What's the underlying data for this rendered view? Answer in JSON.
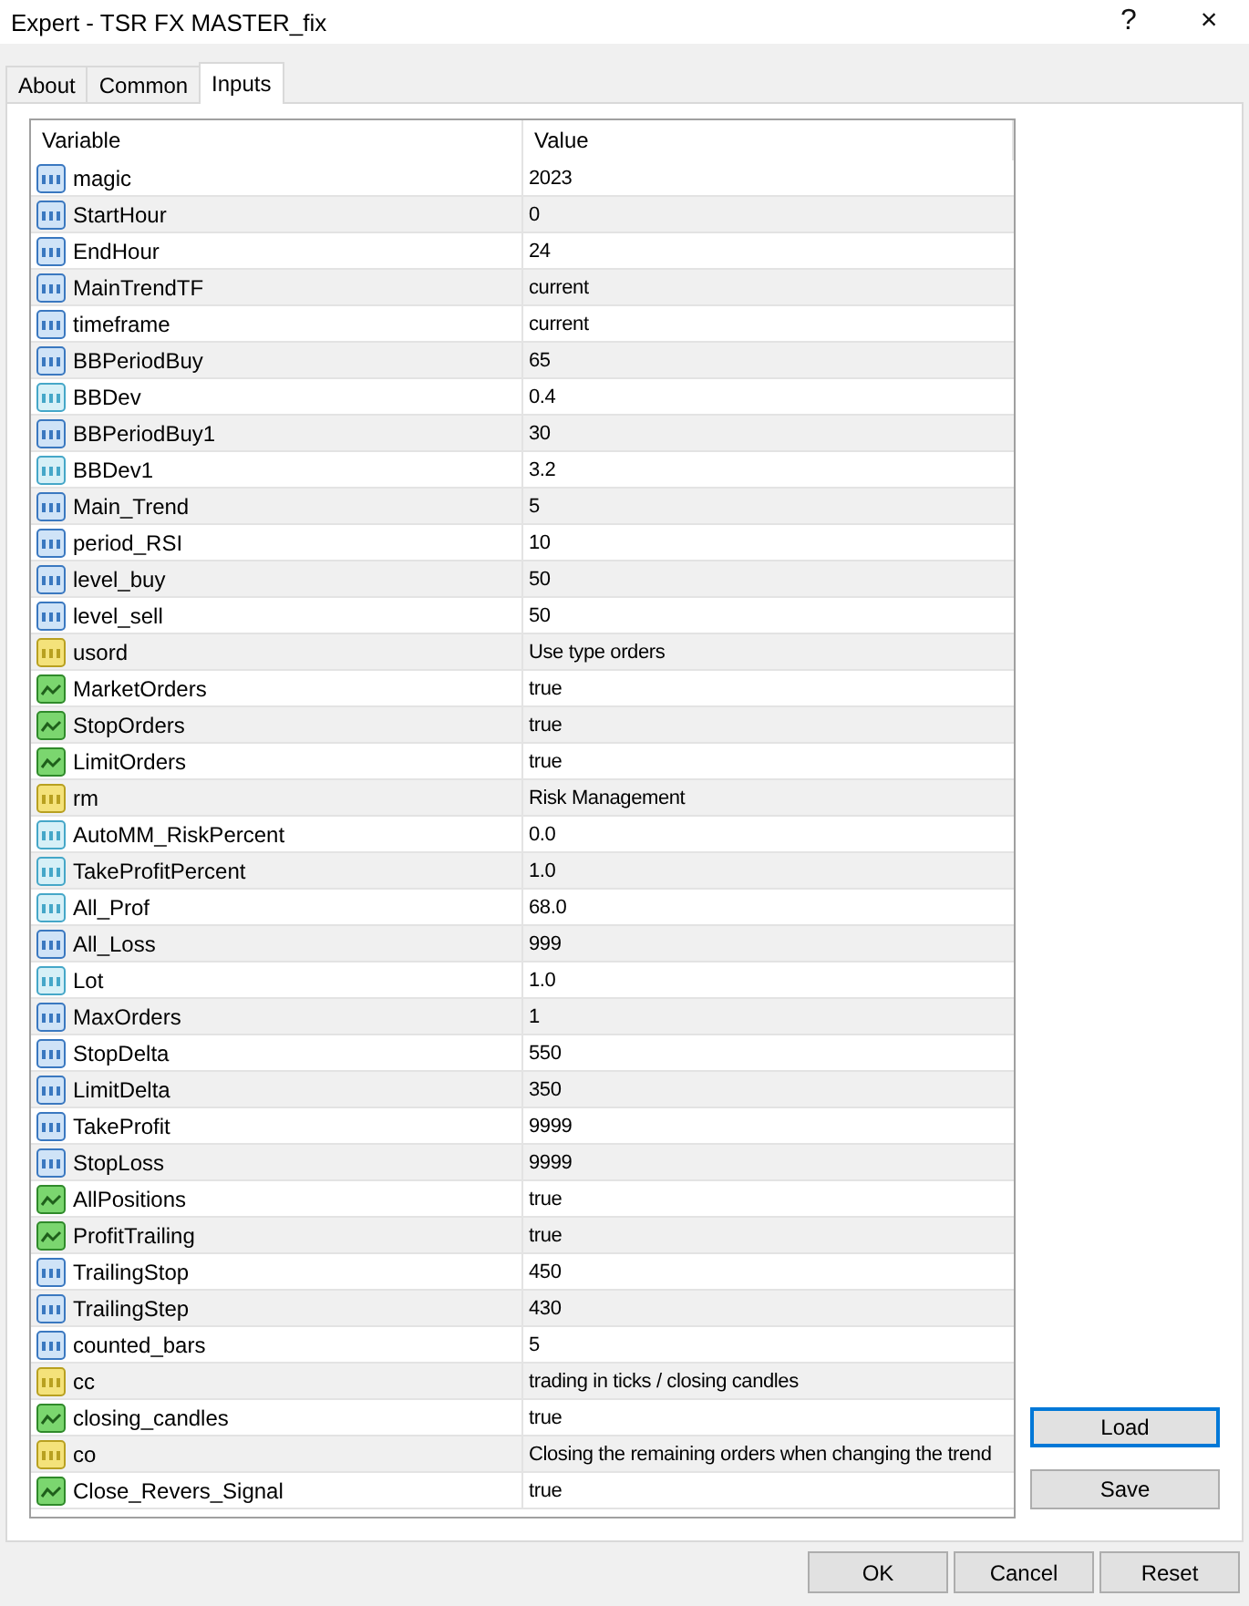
{
  "window": {
    "title": "Expert - TSR FX MASTER_fix",
    "help": "?",
    "close": "×"
  },
  "tabs": [
    {
      "label": "About",
      "selected": false
    },
    {
      "label": "Common",
      "selected": false
    },
    {
      "label": "Inputs",
      "selected": true
    }
  ],
  "table": {
    "columns": [
      "Variable",
      "Value"
    ],
    "rows": [
      {
        "kind": "int",
        "name": "magic",
        "value": "2023"
      },
      {
        "kind": "int",
        "name": "StartHour",
        "value": "0"
      },
      {
        "kind": "int",
        "name": "EndHour",
        "value": "24"
      },
      {
        "kind": "int",
        "name": "MainTrendTF",
        "value": "current"
      },
      {
        "kind": "int",
        "name": "timeframe",
        "value": "current"
      },
      {
        "kind": "int",
        "name": "BBPeriodBuy",
        "value": "65"
      },
      {
        "kind": "double",
        "name": "BBDev",
        "value": "0.4"
      },
      {
        "kind": "int",
        "name": "BBPeriodBuy1",
        "value": "30"
      },
      {
        "kind": "double",
        "name": "BBDev1",
        "value": "3.2"
      },
      {
        "kind": "int",
        "name": "Main_Trend",
        "value": "5"
      },
      {
        "kind": "int",
        "name": "period_RSI",
        "value": "10"
      },
      {
        "kind": "int",
        "name": "level_buy",
        "value": "50"
      },
      {
        "kind": "int",
        "name": "level_sell",
        "value": "50"
      },
      {
        "kind": "string",
        "name": "usord",
        "value": "Use type orders"
      },
      {
        "kind": "bool",
        "name": "MarketOrders",
        "value": "true"
      },
      {
        "kind": "bool",
        "name": "StopOrders",
        "value": "true"
      },
      {
        "kind": "bool",
        "name": "LimitOrders",
        "value": "true"
      },
      {
        "kind": "string",
        "name": "rm",
        "value": "Risk Management"
      },
      {
        "kind": "double",
        "name": "AutoMM_RiskPercent",
        "value": "0.0"
      },
      {
        "kind": "double",
        "name": "TakeProfitPercent",
        "value": "1.0"
      },
      {
        "kind": "double",
        "name": "All_Prof",
        "value": "68.0"
      },
      {
        "kind": "int",
        "name": "All_Loss",
        "value": "999"
      },
      {
        "kind": "double",
        "name": "Lot",
        "value": "1.0"
      },
      {
        "kind": "int",
        "name": "MaxOrders",
        "value": "1"
      },
      {
        "kind": "int",
        "name": "StopDelta",
        "value": "550"
      },
      {
        "kind": "int",
        "name": "LimitDelta",
        "value": "350"
      },
      {
        "kind": "int",
        "name": "TakeProfit",
        "value": "9999"
      },
      {
        "kind": "int",
        "name": "StopLoss",
        "value": "9999"
      },
      {
        "kind": "bool",
        "name": "AllPositions",
        "value": "true"
      },
      {
        "kind": "bool",
        "name": "ProfitTrailing",
        "value": "true"
      },
      {
        "kind": "int",
        "name": "TrailingStop",
        "value": "450"
      },
      {
        "kind": "int",
        "name": "TrailingStep",
        "value": "430"
      },
      {
        "kind": "int",
        "name": "counted_bars",
        "value": "5"
      },
      {
        "kind": "string",
        "name": "cc",
        "value": "trading in ticks / closing candles"
      },
      {
        "kind": "bool",
        "name": "closing_candles",
        "value": "true"
      },
      {
        "kind": "string",
        "name": "co",
        "value": "Closing the remaining orders when changing the trend"
      },
      {
        "kind": "bool",
        "name": "Close_Revers_Signal",
        "value": "true"
      }
    ]
  },
  "side_buttons": [
    {
      "label": "Load",
      "focused": true
    },
    {
      "label": "Save",
      "focused": false
    }
  ],
  "buttons": [
    "OK",
    "Cancel",
    "Reset"
  ]
}
